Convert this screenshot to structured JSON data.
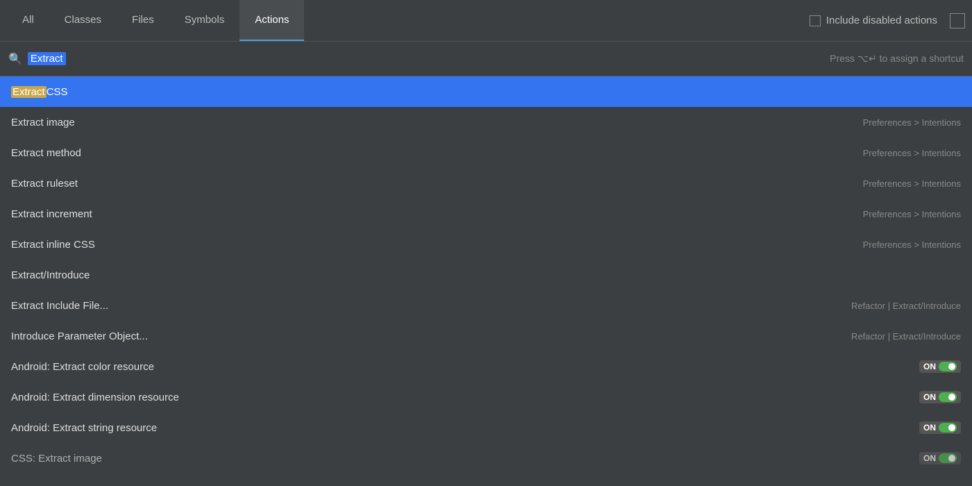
{
  "tabs": [
    {
      "id": "all",
      "label": "All",
      "active": false
    },
    {
      "id": "classes",
      "label": "Classes",
      "active": false
    },
    {
      "id": "files",
      "label": "Files",
      "active": false
    },
    {
      "id": "symbols",
      "label": "Symbols",
      "active": false
    },
    {
      "id": "actions",
      "label": "Actions",
      "active": true
    }
  ],
  "include_disabled": {
    "label": "Include disabled actions",
    "checked": false
  },
  "search": {
    "value": "Extract",
    "shortcut_hint": "Press ⌥↵ to assign a shortcut"
  },
  "results": [
    {
      "id": 1,
      "label_prefix": "Extract",
      "label_suffix": " CSS",
      "highlight_prefix": true,
      "category": "",
      "selected": true,
      "toggle": false
    },
    {
      "id": 2,
      "label_prefix": "Extract",
      "label_suffix": " image",
      "highlight_prefix": false,
      "category": "Preferences > Intentions",
      "selected": false,
      "toggle": false
    },
    {
      "id": 3,
      "label_prefix": "Extract",
      "label_suffix": " method",
      "highlight_prefix": false,
      "category": "Preferences > Intentions",
      "selected": false,
      "toggle": false
    },
    {
      "id": 4,
      "label_prefix": "Extract",
      "label_suffix": " ruleset",
      "highlight_prefix": false,
      "category": "Preferences > Intentions",
      "selected": false,
      "toggle": false
    },
    {
      "id": 5,
      "label_prefix": "Extract",
      "label_suffix": " increment",
      "highlight_prefix": false,
      "category": "Preferences > Intentions",
      "selected": false,
      "toggle": false
    },
    {
      "id": 6,
      "label_prefix": "Extract",
      "label_suffix": " inline CSS",
      "highlight_prefix": false,
      "category": "Preferences > Intentions",
      "selected": false,
      "toggle": false
    },
    {
      "id": 7,
      "label_prefix": "Extract",
      "label_suffix": "/Introduce",
      "highlight_prefix": false,
      "category": "",
      "selected": false,
      "toggle": false
    },
    {
      "id": 8,
      "label_prefix": "Extract",
      "label_suffix": " Include File...",
      "highlight_prefix": false,
      "category": "Refactor | Extract/Introduce",
      "selected": false,
      "toggle": false
    },
    {
      "id": 9,
      "label_prefix": "Introduce",
      "label_suffix": " Parameter Object...",
      "highlight_prefix": false,
      "category": "Refactor | Extract/Introduce",
      "selected": false,
      "toggle": false
    },
    {
      "id": 10,
      "label_prefix": "Android: Extract",
      "label_suffix": " color resource",
      "highlight_prefix": false,
      "category": "",
      "selected": false,
      "toggle": true
    },
    {
      "id": 11,
      "label_prefix": "Android: Extract",
      "label_suffix": " dimension resource",
      "highlight_prefix": false,
      "category": "",
      "selected": false,
      "toggle": true
    },
    {
      "id": 12,
      "label_prefix": "Android: Extract",
      "label_suffix": " string resource",
      "highlight_prefix": false,
      "category": "",
      "selected": false,
      "toggle": true
    },
    {
      "id": 13,
      "label_prefix": "CSS: Extract",
      "label_suffix": " image",
      "highlight_prefix": false,
      "category": "",
      "selected": false,
      "toggle": true
    }
  ],
  "toggle_label": "ON"
}
